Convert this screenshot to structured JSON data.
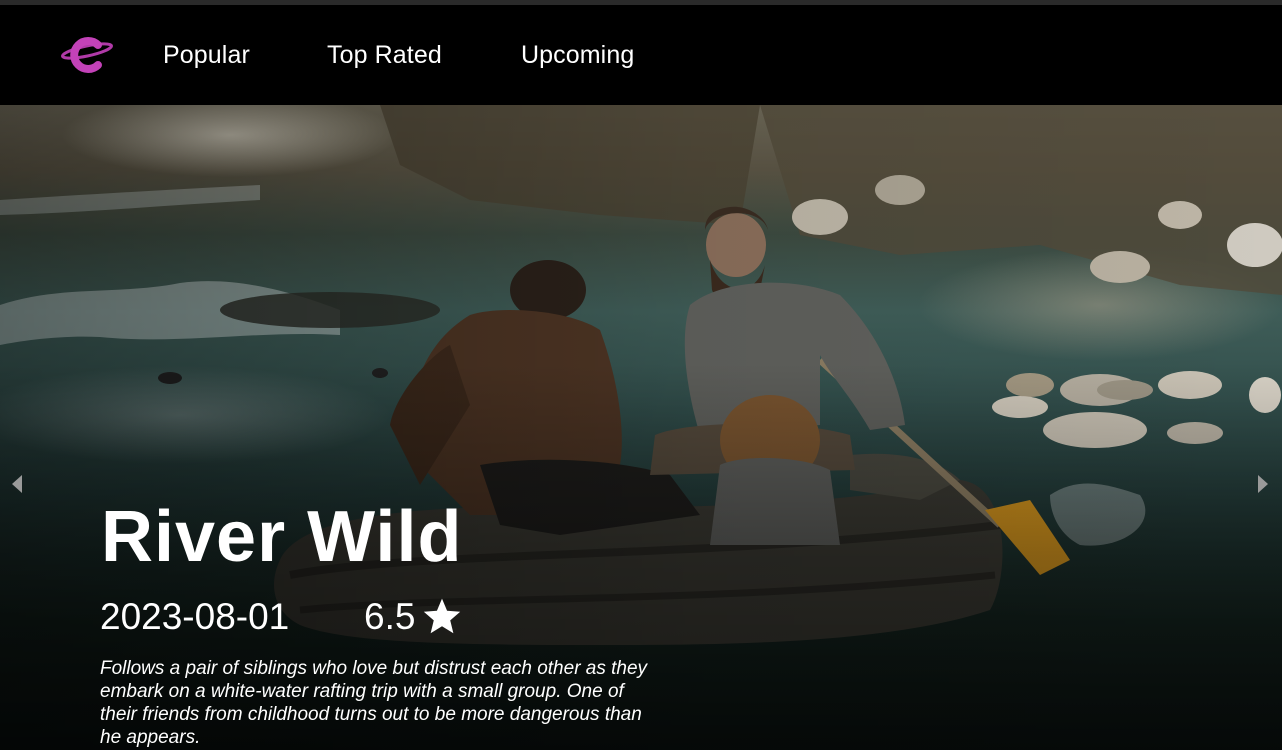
{
  "nav": {
    "logo_icon": "planet-c-logo-icon",
    "logo_color": "#b03aa8",
    "links": [
      {
        "label": "Popular"
      },
      {
        "label": "Top Rated"
      },
      {
        "label": "Upcoming"
      }
    ]
  },
  "hero": {
    "title": "River Wild",
    "release_date": "2023-08-01",
    "rating": "6.5",
    "rating_icon": "star-icon",
    "overview": "Follows a pair of siblings who love but distrust each other as they embark on a white-water rafting trip with a small group. One of their friends from childhood turns out to be more dangerous than he appears.",
    "prev_icon": "caret-left-icon",
    "next_icon": "caret-right-icon"
  }
}
